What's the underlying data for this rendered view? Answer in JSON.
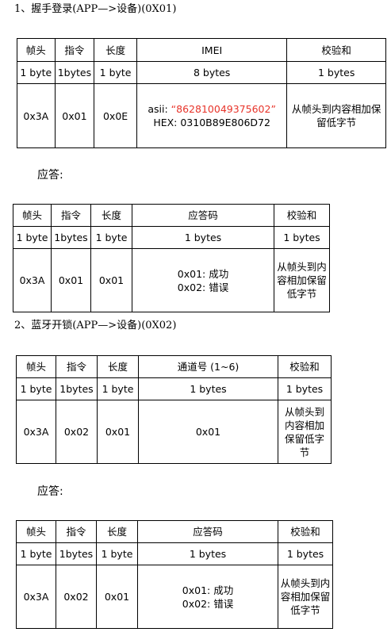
{
  "section1": {
    "heading": "1、握手登录(APP—>设备)(0X01)",
    "table": {
      "headers": [
        "帧头",
        "指令",
        "长度",
        "IMEI",
        "校验和"
      ],
      "sizes": [
        "1 byte",
        "1bytes",
        "1 byte",
        "8 bytes",
        "1 bytes"
      ],
      "values": {
        "frame": "0x3A",
        "cmd": "0x01",
        "len": "0x0E",
        "imei_ascii_label": "asii:",
        "imei_ascii_value": "“862810049375602”",
        "imei_hex": "HEX: 0310B89E806D72",
        "checksum": "从帧头到内容相加保留低字节"
      }
    }
  },
  "reply1": {
    "label": "应答:",
    "table": {
      "headers": [
        "帧头",
        "指令",
        "长度",
        "应答码",
        "校验和"
      ],
      "sizes": [
        "1 byte",
        "1bytes",
        "1 byte",
        "1 bytes",
        "1 bytes"
      ],
      "values": {
        "frame": "0x3A",
        "cmd": "0x01",
        "len": "0x01",
        "code_ok": "0x01: 成功",
        "code_err": "0x02: 错误",
        "checksum": "从帧头到内容相加保留低字节"
      }
    }
  },
  "section2": {
    "heading": "2、蓝牙开锁(APP—>设备)(0X02)",
    "table": {
      "headers": [
        "帧头",
        "指令",
        "长度",
        "通道号 (1~6)",
        "校验和"
      ],
      "sizes": [
        "1 byte",
        "1bytes",
        "1 byte",
        "1 bytes",
        "1 bytes"
      ],
      "values": {
        "frame": "0x3A",
        "cmd": "0x02",
        "len": "0x01",
        "channel": "0x01",
        "checksum": "从帧头到内容相加保留低字节"
      }
    }
  },
  "reply2": {
    "label": "应答:",
    "table": {
      "headers": [
        "帧头",
        "指令",
        "长度",
        "应答码",
        "校验和"
      ],
      "sizes": [
        "1 byte",
        "1bytes",
        "1 byte",
        "1 bytes",
        "1 bytes"
      ],
      "values": {
        "frame": "0x3A",
        "cmd": "0x02",
        "len": "0x01",
        "code_ok": "0x01: 成功",
        "code_err": "0x02: 错误",
        "checksum": "从帧头到内容相加保留低字节"
      }
    }
  },
  "colors": {
    "highlight": "#e8342a",
    "border": "#000000"
  }
}
